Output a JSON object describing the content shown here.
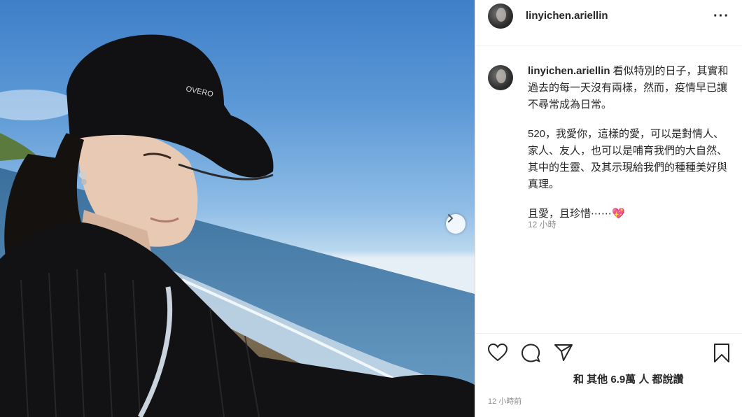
{
  "post": {
    "username": "linyichen.ariellin",
    "cap_text": "OVERO"
  },
  "caption": {
    "username": "linyichen.ariellin",
    "para1": "看似特別的日子，其實和過去的每一天沒有兩樣，然而，疫情早已讓不尋常成為日常。",
    "para2": "520，我愛你，這樣的愛，可以是對情人、家人、友人，也可以是哺育我們的大自然、其中的生靈、及其示現給我們的種種美好與真理。",
    "para3": "且愛，且珍惜⋯⋯💖",
    "time": "12 小時"
  },
  "actions": {
    "likes_text": "和 其他 6.9萬 人 都說讚",
    "post_time": "12 小時前"
  },
  "icons": {
    "more": "more-options-icon",
    "like": "heart-icon",
    "comment": "comment-icon",
    "share": "share-icon",
    "save": "bookmark-icon",
    "next": "chevron-right-icon"
  },
  "colors": {
    "text": "#262626",
    "muted": "#8e8e8e",
    "border": "#dbdbdb"
  }
}
